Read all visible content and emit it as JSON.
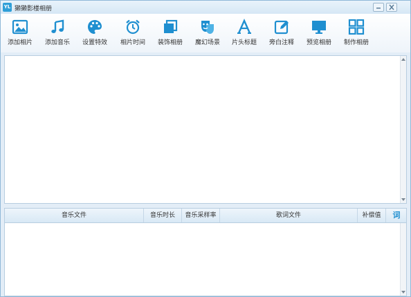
{
  "window": {
    "logo_text": "YL",
    "title": "獭獭影楼相册"
  },
  "toolbar": {
    "items": [
      {
        "label": "添加相片",
        "icon": "image-icon"
      },
      {
        "label": "添加音乐",
        "icon": "music-note-icon"
      },
      {
        "label": "设置特效",
        "icon": "palette-icon"
      },
      {
        "label": "相片时间",
        "icon": "alarm-clock-icon"
      },
      {
        "label": "装饰相册",
        "icon": "layers-icon"
      },
      {
        "label": "魔幻场景",
        "icon": "theater-mask-icon"
      },
      {
        "label": "片头标题",
        "icon": "title-a-icon"
      },
      {
        "label": "旁白注释",
        "icon": "edit-pen-icon"
      },
      {
        "label": "预览相册",
        "icon": "monitor-icon"
      },
      {
        "label": "制作相册",
        "icon": "grid-icon"
      }
    ]
  },
  "music_table": {
    "columns": [
      "音乐文件",
      "音乐时长",
      "音乐采样率",
      "歌词文件",
      "补偿值"
    ],
    "lyric_button": "词",
    "rows": []
  },
  "colors": {
    "accent": "#1f8fd0",
    "panel_border": "#b7cde0",
    "header_bg": "#d8e8f5"
  }
}
